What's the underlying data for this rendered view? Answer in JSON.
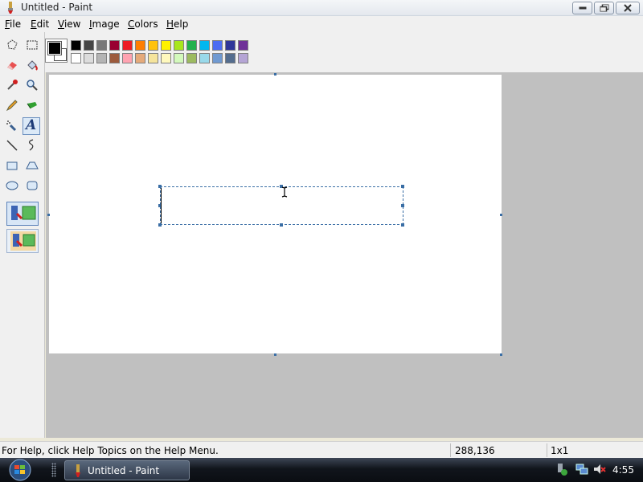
{
  "window": {
    "title": "Untitled - Paint"
  },
  "menu": {
    "items": [
      "File",
      "Edit",
      "View",
      "Image",
      "Colors",
      "Help"
    ]
  },
  "palette": {
    "foreground": "#000000",
    "background": "#ffffff",
    "row1": [
      "#000000",
      "#464646",
      "#787878",
      "#990030",
      "#ed1c24",
      "#ff7e00",
      "#ffc20e",
      "#fff200",
      "#a8e61d",
      "#22b14c",
      "#00b7ef",
      "#4d6df3",
      "#2f3699",
      "#6f3198"
    ],
    "row2": [
      "#ffffff",
      "#dcdcdc",
      "#b4b4b4",
      "#9c5a3c",
      "#ffa3b1",
      "#e5aa7a",
      "#f5e49c",
      "#fff9bd",
      "#d3f9bc",
      "#9dbb61",
      "#99d9ea",
      "#709ad1",
      "#546d8e",
      "#b5a5d5"
    ]
  },
  "toolbox": {
    "tools": [
      "free-form-select",
      "select",
      "eraser",
      "fill-with-color",
      "pick-color",
      "magnifier",
      "pencil",
      "brush",
      "airbrush",
      "text",
      "line",
      "curve",
      "rectangle",
      "polygon",
      "ellipse",
      "rounded-rectangle"
    ],
    "active_tool": "text",
    "text_tool_glyph": "A"
  },
  "status": {
    "help": "For Help, click Help Topics on the Help Menu.",
    "coords": "288,136",
    "size": "1x1"
  },
  "taskbar": {
    "task_label": "Untitled - Paint",
    "clock": "4:55"
  }
}
